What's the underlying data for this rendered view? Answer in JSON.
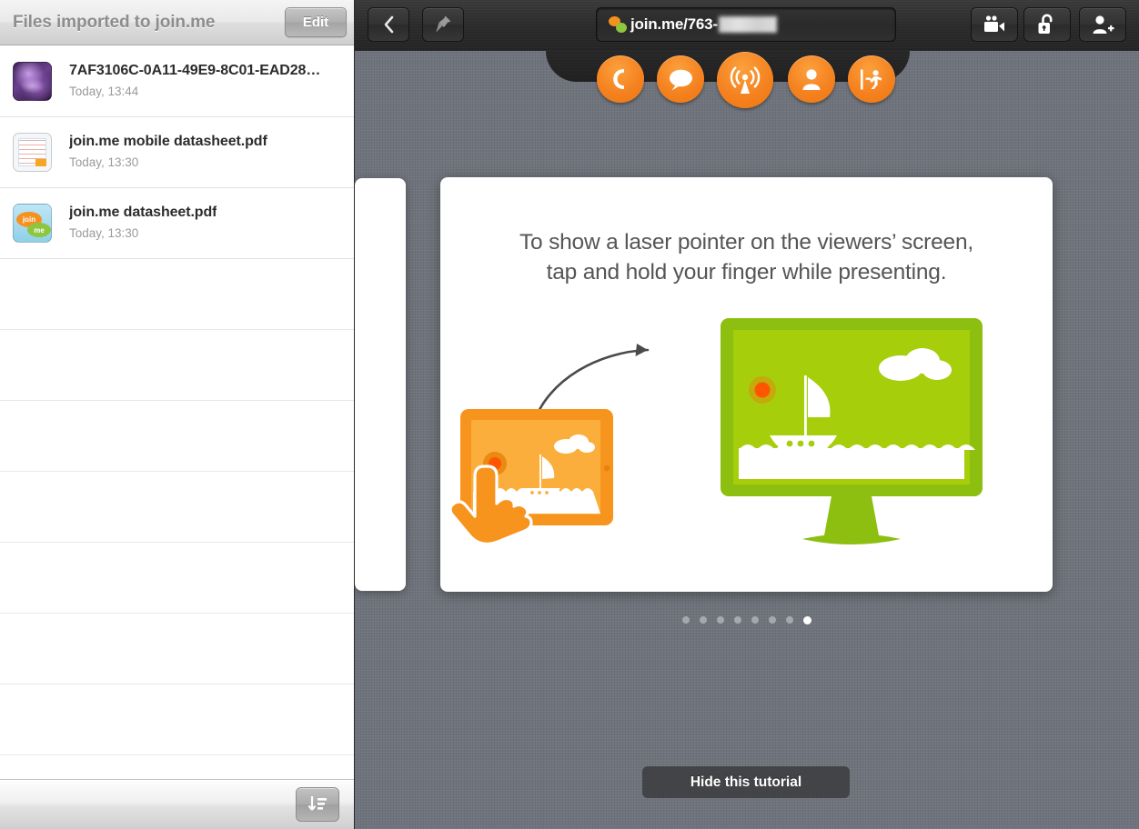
{
  "sidebar": {
    "title": "Files imported to join.me",
    "edit_label": "Edit",
    "sort_icon": "sort-descending-icon",
    "files": [
      {
        "name": "7AF3106C-0A11-49E9-8C01-EAD28…",
        "date": "Today, 13:44",
        "thumb": "image-thumbnail"
      },
      {
        "name": "join.me mobile datasheet.pdf",
        "date": "Today, 13:30",
        "thumb": "document-thumbnail"
      },
      {
        "name": "join.me datasheet.pdf",
        "date": "Today, 13:30",
        "thumb": "joinme-logo-thumbnail"
      }
    ],
    "empty_row_count": 8,
    "joinme_logo": {
      "top_word": "join",
      "bottom_word": "me"
    }
  },
  "topbar": {
    "back_icon": "chevron-left-icon",
    "pin_icon": "pushpin-icon",
    "url": "join.me/763-",
    "url_redacted": true,
    "record_icon": "video-camera-icon",
    "lock_icon": "open-padlock-icon",
    "invite_icon": "add-person-icon"
  },
  "actions": [
    {
      "name": "audio-button",
      "icon": "phone-icon",
      "size": "small"
    },
    {
      "name": "chat-button",
      "icon": "chat-bubble-icon",
      "size": "small"
    },
    {
      "name": "present-button",
      "icon": "broadcast-icon",
      "size": "large"
    },
    {
      "name": "people-button",
      "icon": "person-icon",
      "size": "small"
    },
    {
      "name": "leave-button",
      "icon": "exit-running-icon",
      "size": "small"
    }
  ],
  "tutorial": {
    "line1": "To show a laser pointer on the viewers’ screen,",
    "line2": "tap and hold your finger while presenting.",
    "hide_label": "Hide this tutorial",
    "page_count": 8,
    "active_page": 8
  },
  "colors": {
    "accent_orange": "#F58220",
    "accent_green": "#9FCC0B",
    "laser_red": "#FF5500",
    "tablet_orange": "#F7941E",
    "background_gray": "#6F737B",
    "chrome_dark": "#2B2B2B"
  }
}
